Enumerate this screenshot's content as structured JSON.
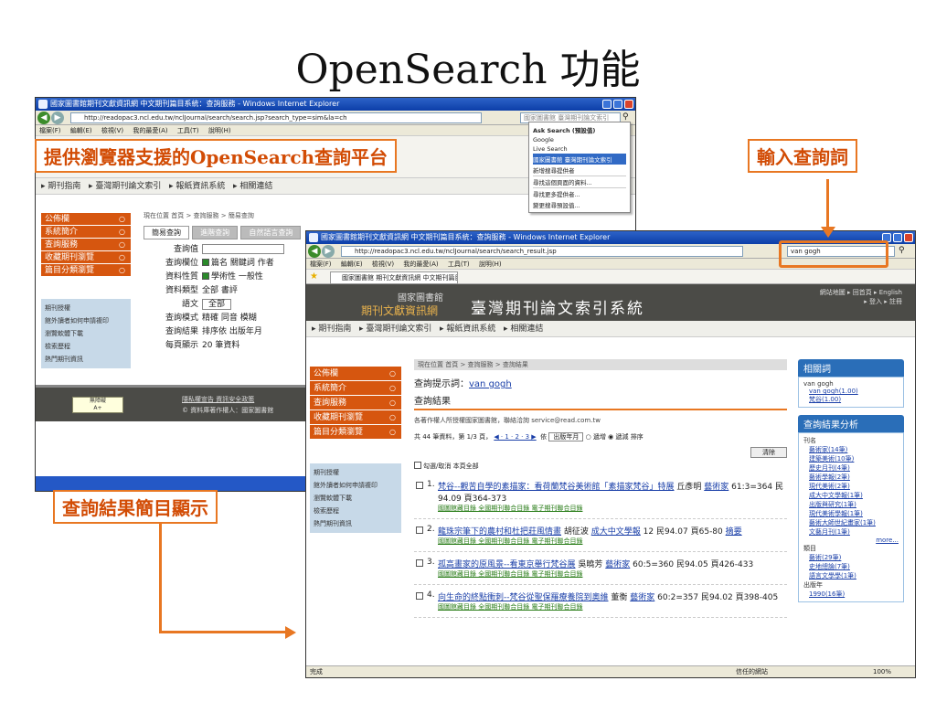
{
  "slide": {
    "title": "OpenSearch 功能",
    "label_platform": "提供瀏覽器支援的OpenSearch查詢平台",
    "label_input": "輸入查詢詞",
    "label_results": "查詢結果簡目顯示"
  },
  "back_window": {
    "title": "國家圖書館期刊文獻資訊網 中文期刊篇目系統：查詢服務 - Windows Internet Explorer",
    "url": "http://readopac3.ncl.edu.tw/nclJournal/search/search.jsp?search_type=sim&la=ch",
    "search_placeholder": "國家圖書館 臺灣期刊論文索引",
    "menu": [
      "檔案(F)",
      "編輯(E)",
      "檢視(V)",
      "我的最愛(A)",
      "工具(T)",
      "說明(H)"
    ],
    "nav": [
      "期刊指南",
      "臺灣期刊論文索引",
      "報紙資訊系統",
      "相關連結"
    ],
    "left_menu": [
      "公佈欄",
      "系統簡介",
      "查詢服務",
      "收藏期刊瀏覽",
      "篇目分類瀏覽"
    ],
    "left_sub": [
      "期刊授權",
      "館外讀者如何申請複印",
      "瀏覽軟體下載",
      "檢索歷程",
      "熱門期刊資訊"
    ],
    "location": "現在位置 首頁 > 查詢服務 > 簡易查詢",
    "tabs": [
      "簡易查詢",
      "進階查詢",
      "自然語言查詢"
    ],
    "form": [
      {
        "label": "查詢值",
        "value": ""
      },
      {
        "label": "查詢欄位",
        "value": "篇名 關鍵詞 作者"
      },
      {
        "label": "資料性質",
        "value": "學術性 一般性"
      },
      {
        "label": "資料類型",
        "value": "全部 書評"
      },
      {
        "label": "語文",
        "value": "全部"
      },
      {
        "label": "查詢模式",
        "value": "精確 同音 模糊"
      },
      {
        "label": "查詢結果",
        "value": "排序依 出版年月"
      },
      {
        "label": "每頁顯示",
        "value": "20 筆資料"
      }
    ],
    "footer_links": "隱私權宣告 資訊安全政策",
    "footer_copy": "© 資料庫著作權人：國家圖書館",
    "dropdown": [
      "Ask Search (預設值)",
      "Google",
      "Live Search",
      "國家圖書館 臺灣期刊論文索引",
      "新增搜尋提供者",
      "尋找這個頁面的資料...",
      "尋找更多提供者...",
      "變更搜尋預設值..."
    ]
  },
  "front_window": {
    "title": "國家圖書館期刊文獻資訊網 中文期刊篇目系統：查詢服務 - Windows Internet Explorer",
    "url": "http://readopac3.ncl.edu.tw/nclJournal/search/search_result.jsp",
    "search_value": "van gogh",
    "menu": [
      "檔案(F)",
      "編輯(E)",
      "檢視(V)",
      "我的最愛(A)",
      "工具(T)",
      "說明(H)"
    ],
    "tab_label": "國家圖書館 期刊文獻資訊網 中文期刊篇目系...",
    "brand_org": "國家圖書館",
    "brand_sub": "期刊文獻資訊網",
    "system_name": "臺灣期刊論文索引系統",
    "top_links": "網站地圖 ▸ 回首頁 ▸ English",
    "top_links2": "▸ 登入 ▸ 註冊",
    "nav": [
      "期刊指南",
      "臺灣期刊論文索引",
      "報紙資訊系統",
      "相關連結"
    ],
    "left_menu": [
      "公佈欄",
      "系統簡介",
      "查詢服務",
      "收藏期刊瀏覽",
      "篇目分類瀏覽"
    ],
    "left_sub": [
      "期刊授權",
      "館外讀者如何申請複印",
      "瀏覽軟體下載",
      "檢索歷程",
      "熱門期刊資訊"
    ],
    "location": "現在位置 首頁 > 查詢服務 > 查詢結果",
    "hint_label": "查詢提示詞：",
    "hint_value": "van gogh",
    "result_heading": "查詢結果",
    "notice": "各著作權人所授權國家圖書館，聯絡洽詢 service@read.com.tw",
    "summary": "共 44 筆資料，第 1/3 頁，",
    "pages": "◀ · 1 · 2 · 3 ▶",
    "sort_label": "依",
    "sort_value": "出版年月",
    "sort_asc": "遞增",
    "sort_desc": "遞減 排序",
    "clear_button": "清除",
    "select_all": "勾選/取消 本頁全部",
    "results": [
      {
        "num": "1.",
        "title": "梵谷--觀苦自學的素描家：看荷蘭梵谷美術館「素描家梵谷」特展",
        "author": "丘彥明",
        "journal": "藝術家",
        "meta": "61:3=364 民94.09 頁364-373"
      },
      {
        "num": "2.",
        "title": "龍珠宗筆下的農村和杜把莊風情畫",
        "author": "胡征波",
        "journal": "成大中文學報",
        "meta": "12 民94.07 頁65-80",
        "extra": "摘要"
      },
      {
        "num": "3.",
        "title": "孤高畫家的原風景--看東京舉行梵谷展",
        "author": "吳曉芳",
        "journal": "藝術家",
        "meta": "60:5=360 民94.05 頁426-433"
      },
      {
        "num": "4.",
        "title": "向生命的終點衝刺--梵谷從聖保羅療養院到奧維",
        "author": "董衡",
        "journal": "藝術家",
        "meta": "60:2=357 民94.02 頁398-405"
      }
    ],
    "result_links": "國圖館藏目錄 全國期刊聯合目錄 電子期刊聯合目錄",
    "related_head": "相關詞",
    "related_query": "van gogh",
    "related_items": [
      "van gogh(1.00)",
      "梵谷(1.00)"
    ],
    "analysis_head": "查詢結果分析",
    "analysis_groups": [
      {
        "name": "刊名",
        "items": [
          "藝術家(14筆)",
          "建築美術(10筆)",
          "歷史月刊(4筆)",
          "藝術學報(2筆)",
          "現代美術(2筆)",
          "成大中文學報(1筆)",
          "出版與研究(1筆)",
          "現代美術學報(1筆)",
          "藝術大師世紀畫家(1筆)",
          "文藝月刊(1筆)"
        ]
      },
      {
        "name": "類目",
        "items": [
          "藝術(29筆)",
          "史地總論(7筆)",
          "語言文學學(1筆)"
        ]
      },
      {
        "name": "出版年",
        "items": [
          "1990(16筆)"
        ]
      }
    ],
    "more": "more...",
    "status_left": "完成",
    "status_zone": "信任的網站",
    "status_zoom": "100%"
  }
}
